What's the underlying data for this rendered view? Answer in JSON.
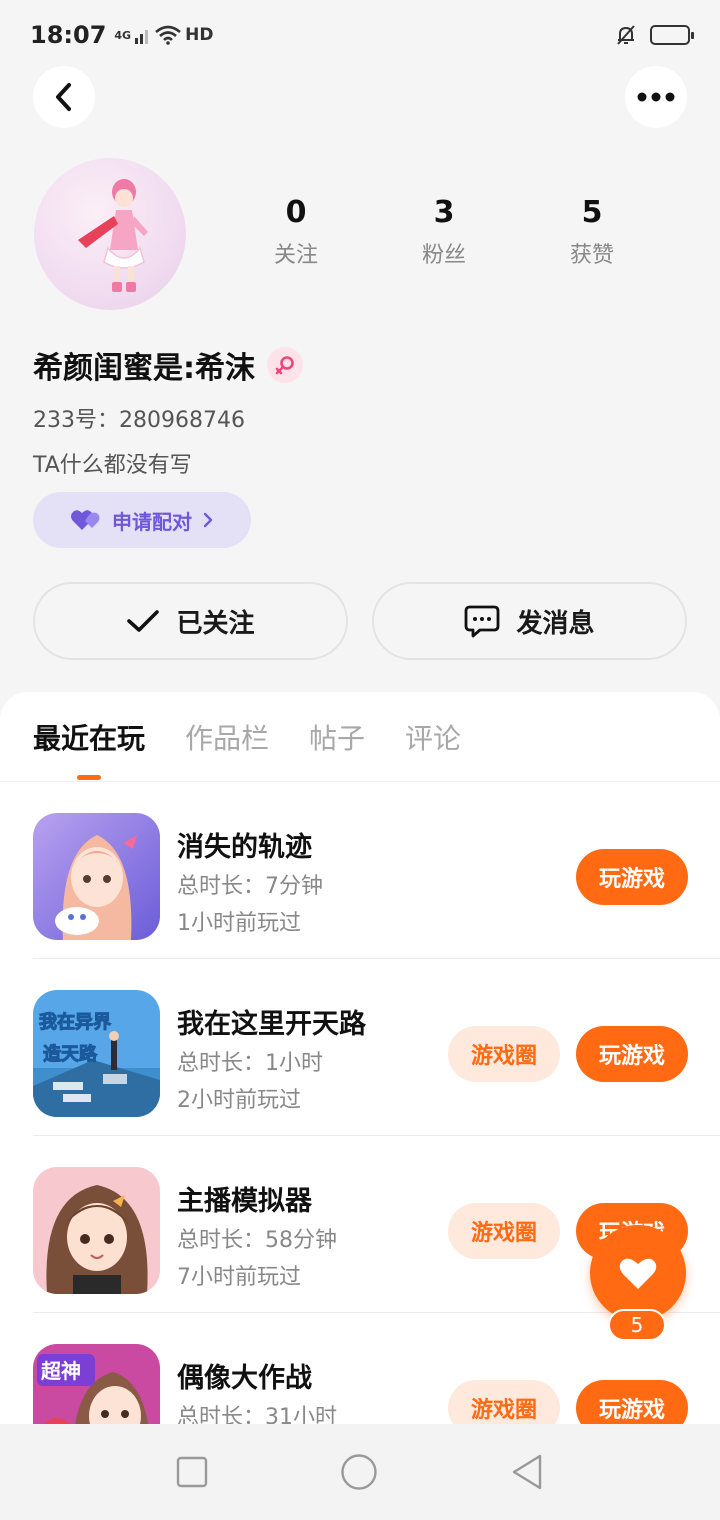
{
  "status_bar": {
    "time": "18:07",
    "network": "4G",
    "hd": "HD"
  },
  "nav": {
    "back_icon": "chevron-left-icon",
    "more_icon": "more-dots-icon"
  },
  "profile": {
    "name": "希颜闺蜜是:希沫",
    "gender_icon": "female-icon",
    "uid": "233号：280968746",
    "bio": "TA什么都没有写",
    "stats": [
      {
        "value": "0",
        "label": "关注"
      },
      {
        "value": "3",
        "label": "粉丝"
      },
      {
        "value": "5",
        "label": "获赞"
      }
    ],
    "pair_label": "申请配对",
    "follow_label": "已关注",
    "message_label": "发消息"
  },
  "tabs": [
    {
      "label": "最近在玩",
      "active": true
    },
    {
      "label": "作品栏",
      "active": false
    },
    {
      "label": "帖子",
      "active": false
    },
    {
      "label": "评论",
      "active": false
    }
  ],
  "games": [
    {
      "title": "消失的轨迹",
      "duration": "总时长：7分钟",
      "last_played": "1小时前玩过",
      "circle_label": "",
      "play_label": "玩游戏"
    },
    {
      "title": "我在这里开天路",
      "duration": "总时长：1小时",
      "last_played": "2小时前玩过",
      "circle_label": "游戏圈",
      "play_label": "玩游戏",
      "icon_text_1": "我在异界",
      "icon_text_2": "造天路"
    },
    {
      "title": "主播模拟器",
      "duration": "总时长：58分钟",
      "last_played": "7小时前玩过",
      "circle_label": "游戏圈",
      "play_label": "玩游戏"
    },
    {
      "title": "偶像大作战",
      "duration": "总时长：31小时",
      "last_played": "",
      "circle_label": "游戏圈",
      "play_label": "玩游戏",
      "icon_text_1": "超神"
    }
  ],
  "fab": {
    "count": "5",
    "icon": "heart-icon"
  },
  "colors": {
    "accent": "#ff6a13",
    "pair_purple": "#6f58d9",
    "pair_bg": "#e4e0f6"
  }
}
